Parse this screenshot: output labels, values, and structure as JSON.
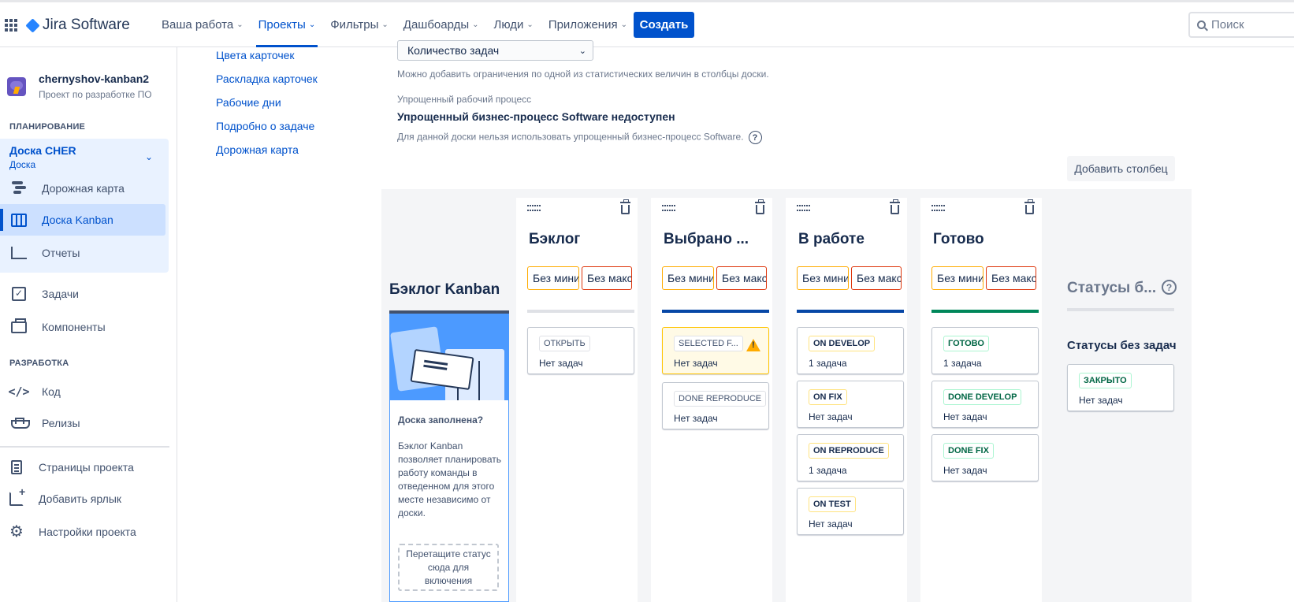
{
  "nav": {
    "product": "Jira Software",
    "items": [
      {
        "label": "Ваша работа"
      },
      {
        "label": "Проекты"
      },
      {
        "label": "Фильтры"
      },
      {
        "label": "Дашбоарды"
      },
      {
        "label": "Люди"
      },
      {
        "label": "Приложения"
      }
    ],
    "create": "Создать",
    "search_placeholder": "Поиск"
  },
  "sidebar": {
    "project_name": "chernyshov-kanban2",
    "project_type": "Проект по разработке ПО",
    "planning_label": "ПЛАНИРОВАНИЕ",
    "board_name": "Доска CHER",
    "board_sub": "Доска",
    "roadmap": "Дорожная карта",
    "kanban": "Доска Kanban",
    "reports": "Отчеты",
    "tasks": "Задачи",
    "components": "Компоненты",
    "dev_label": "РАЗРАБОТКА",
    "code": "Код",
    "releases": "Релизы",
    "project_pages": "Страницы проекта",
    "add_shortcut": "Добавить ярлык",
    "project_settings": "Настройки проекта"
  },
  "submenu": [
    "Цвета карточек",
    "Раскладка карточек",
    "Рабочие дни",
    "Подробно о задаче",
    "Дорожная карта"
  ],
  "settings": {
    "constraint_select": "Количество задач",
    "constraint_hint": "Можно добавить ограничения по одной из статистических величин в столбцы доски.",
    "wf_label": "Упрощенный рабочий процесс",
    "wf_title": "Упрощенный бизнес-процесс Software недоступен",
    "wf_hint": "Для данной доски нельзя использовать упрощенный бизнес-процесс Software.",
    "add_column": "Добавить столбец"
  },
  "backlog": {
    "title": "Бэклог Kanban",
    "question": "Доска заполнена?",
    "text": "Бэклог Kanban позволяет планировать работу команды в отведенном для этого месте независимо от доски.",
    "drop": "Перетащите статус сюда для включения"
  },
  "limits": {
    "min": "Без минимума",
    "max": "Без максимума"
  },
  "columns": [
    {
      "title": "Бэклог",
      "bar_color": "#dfe1e6",
      "statuses": [
        {
          "label": "ОТКРЫТЬ",
          "count": "Нет задач",
          "tone": "grey"
        }
      ]
    },
    {
      "title": "Выбрано ...",
      "bar_color": "#0747a6",
      "statuses": [
        {
          "label": "SELECTED F...",
          "count": "Нет задач",
          "tone": "grey",
          "warning": true
        },
        {
          "label": "DONE REPRODUCE",
          "count": "Нет задач",
          "tone": "grey"
        }
      ]
    },
    {
      "title": "В работе",
      "bar_color": "#0747a6",
      "statuses": [
        {
          "label": "ON DEVELOP",
          "count": "1 задача",
          "tone": "yellow"
        },
        {
          "label": "ON FIX",
          "count": "Нет задач",
          "tone": "yellow"
        },
        {
          "label": "ON REPRODUCE",
          "count": "1 задача",
          "tone": "yellow"
        },
        {
          "label": "ON TEST",
          "count": "Нет задач",
          "tone": "yellow"
        }
      ]
    },
    {
      "title": "Готово",
      "bar_color": "#00875a",
      "statuses": [
        {
          "label": "ГОТОВО",
          "count": "1 задача",
          "tone": "green"
        },
        {
          "label": "DONE DEVELOP",
          "count": "Нет задач",
          "tone": "green"
        },
        {
          "label": "DONE FIX",
          "count": "Нет задач",
          "tone": "green"
        }
      ]
    }
  ],
  "no_status": {
    "title": "Статусы б...",
    "subtitle": "Статусы без задач",
    "status": {
      "label": "ЗАКРЫТО",
      "count": "Нет задач",
      "tone": "green"
    }
  }
}
